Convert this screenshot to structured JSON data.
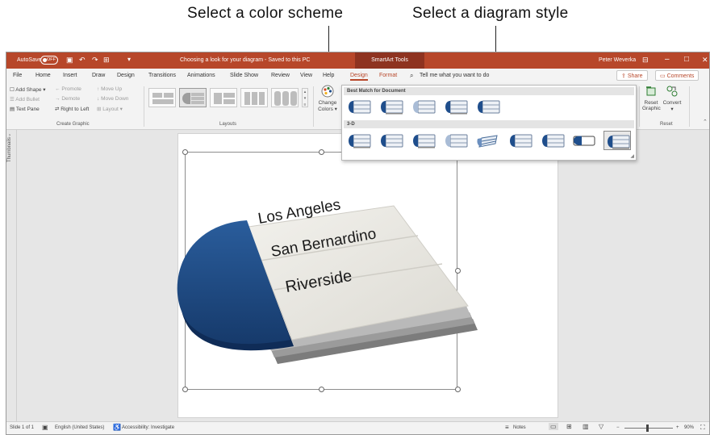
{
  "callouts": {
    "color": "Select a color scheme",
    "style": "Select a diagram style"
  },
  "titlebar": {
    "autosave": "AutoSave",
    "autosave_state": "OFF",
    "doc_title": "Choosing a look for your diagram  -  Saved to this PC",
    "context_tab": "SmartArt Tools",
    "user": "Peter Weverka",
    "min": "–",
    "max": "□",
    "close": "✕"
  },
  "tabs": [
    "File",
    "Home",
    "Insert",
    "Draw",
    "Design",
    "Transitions",
    "Animations",
    "Slide Show",
    "Review",
    "View",
    "Help"
  ],
  "ctx_tabs": {
    "design": "Design",
    "format": "Format"
  },
  "tell_me": "Tell me what you want to do",
  "share": "Share",
  "comments": "Comments",
  "ribbon": {
    "create_graphic": {
      "add_shape": "Add Shape",
      "add_bullet": "Add Bullet",
      "text_pane": "Text Pane",
      "promote": "Promote",
      "demote": "Demote",
      "right_to_left": "Right to Left",
      "move_up": "Move Up",
      "move_down": "Move Down",
      "layout": "Layout",
      "group": "Create Graphic"
    },
    "layouts_group": "Layouts",
    "change_colors": [
      "Change",
      "Colors"
    ],
    "reset": {
      "reset_graphic": [
        "Reset",
        "Graphic"
      ],
      "convert": "Convert",
      "group": "Reset"
    }
  },
  "gallery": {
    "best_match": "Best Match for Document",
    "three_d": "3-D"
  },
  "thumbnails_label": "Thumbnails",
  "diagram": {
    "items": [
      "Los Angeles",
      "San Bernardino",
      "Riverside"
    ],
    "accent": "#1f4e8c"
  },
  "statusbar": {
    "slide": "Slide 1 of 1",
    "language": "English (United States)",
    "accessibility": "Accessibility: Investigate",
    "notes": "Notes",
    "zoom": "90%"
  },
  "colors": {
    "powerpoint_red": "#b7472a",
    "smartart_blue": "#1f4e8c"
  }
}
